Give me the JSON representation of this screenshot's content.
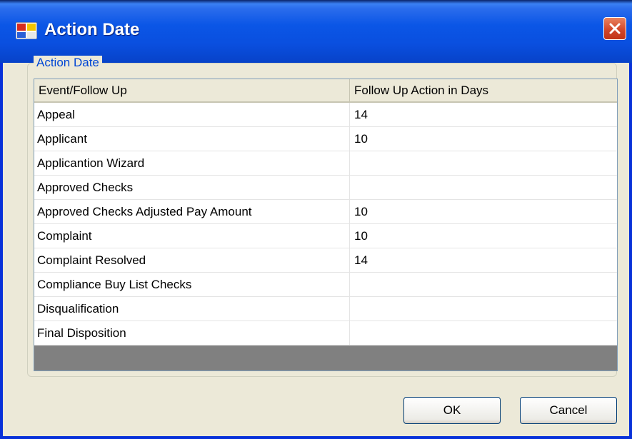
{
  "window": {
    "title": "Action Date",
    "app_icon": "app-window-icon",
    "close_icon": "close-icon"
  },
  "group": {
    "legend": "Action Date"
  },
  "grid": {
    "columns": [
      "Event/Follow Up",
      "Follow Up Action in Days"
    ],
    "rows": [
      {
        "event": "Appeal",
        "days": "14"
      },
      {
        "event": "Applicant",
        "days": "10"
      },
      {
        "event": "Applicantion Wizard",
        "days": ""
      },
      {
        "event": "Approved Checks",
        "days": ""
      },
      {
        "event": "Approved Checks Adjusted Pay Amount",
        "days": "10"
      },
      {
        "event": "Complaint",
        "days": "10"
      },
      {
        "event": "Complaint Resolved",
        "days": "14"
      },
      {
        "event": "Compliance Buy List Checks",
        "days": ""
      },
      {
        "event": "Disqualification",
        "days": ""
      },
      {
        "event": "Final Disposition",
        "days": ""
      }
    ]
  },
  "buttons": {
    "ok": "OK",
    "cancel": "Cancel"
  },
  "colors": {
    "titlebar": "#0b56e6",
    "legend_text": "#0046d5",
    "close_button": "#d2472a",
    "grid_empty_area": "#808080"
  }
}
